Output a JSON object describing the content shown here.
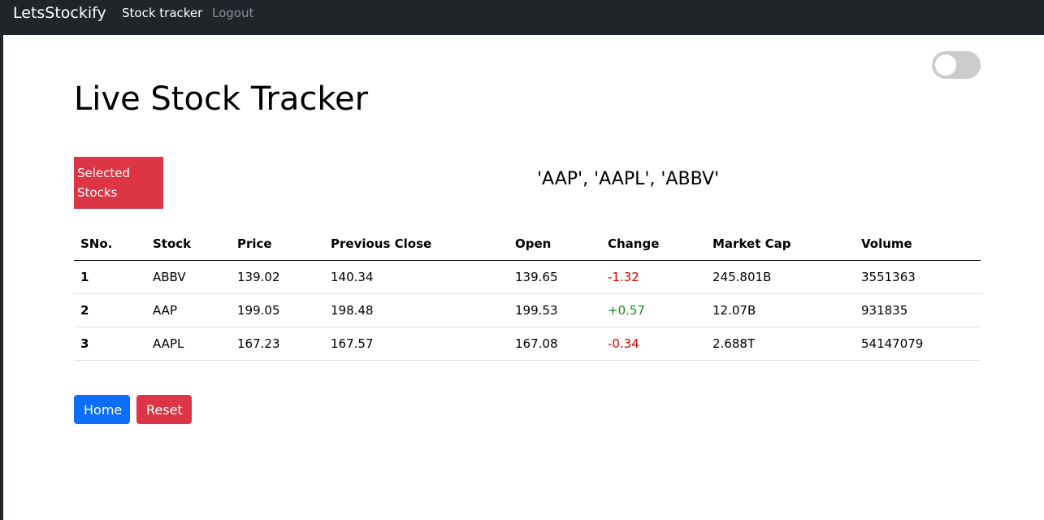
{
  "navbar": {
    "brand": "LetsStockify",
    "links": [
      "Stock tracker",
      "Logout"
    ]
  },
  "page": {
    "title": "Live Stock Tracker",
    "selected_label": "Selected Stocks",
    "selected_stocks": "'AAP', 'AAPL', 'ABBV'"
  },
  "table": {
    "headers": [
      "SNo.",
      "Stock",
      "Price",
      "Previous Close",
      "Open",
      "Change",
      "Market Cap",
      "Volume"
    ],
    "rows": [
      {
        "sno": "1",
        "stock": "ABBV",
        "price": "139.02",
        "prev_close": "140.34",
        "open": "139.65",
        "change": "-1.32",
        "market_cap": "245.801B",
        "volume": "3551363"
      },
      {
        "sno": "2",
        "stock": "AAP",
        "price": "199.05",
        "prev_close": "198.48",
        "open": "199.53",
        "change": "+0.57",
        "market_cap": "12.07B",
        "volume": "931835"
      },
      {
        "sno": "3",
        "stock": "AAPL",
        "price": "167.23",
        "prev_close": "167.57",
        "open": "167.08",
        "change": "-0.34",
        "market_cap": "2.688T",
        "volume": "54147079"
      }
    ]
  },
  "buttons": {
    "home": "Home",
    "reset": "Reset"
  },
  "toggle": {
    "state": "off"
  },
  "colors": {
    "navbar_bg": "#212529",
    "accent_red": "#dc3545",
    "accent_blue": "#0d6efd",
    "negative": "#e00000",
    "positive": "#1a8a1a"
  }
}
